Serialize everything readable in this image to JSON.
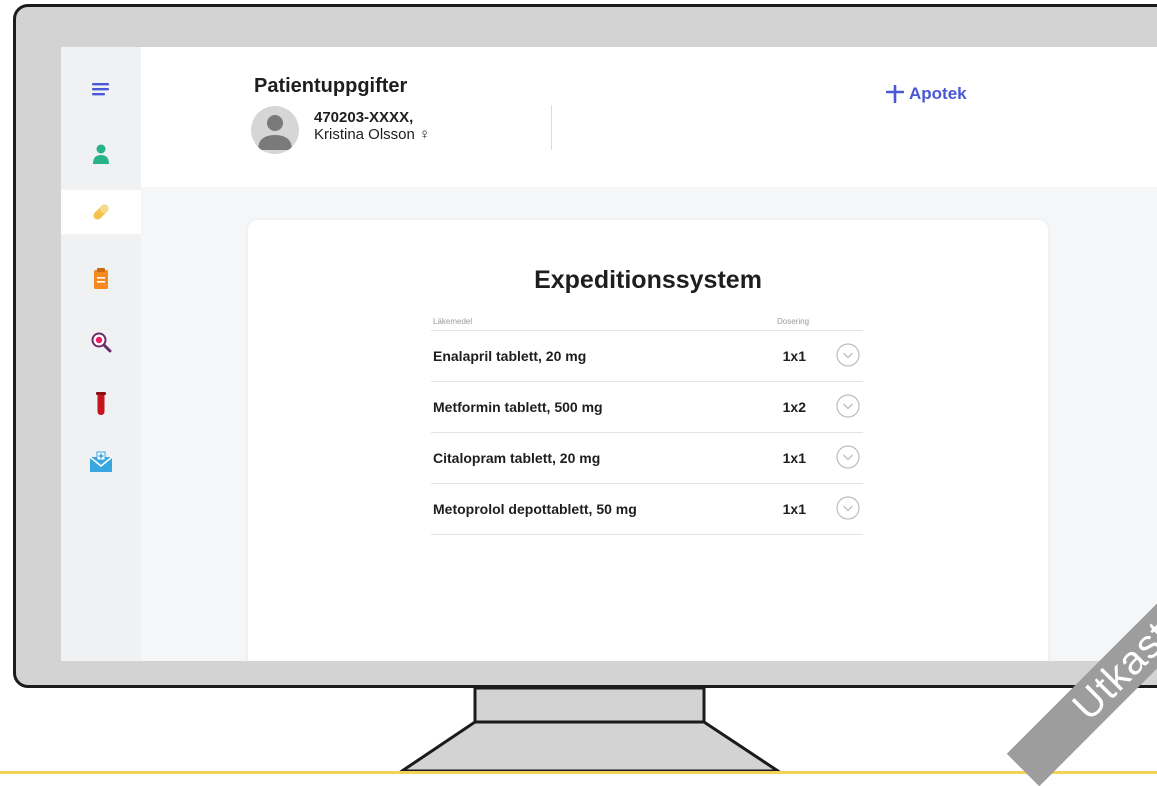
{
  "header": {
    "title": "Patientuppgifter",
    "patient_id": "470203-XXXX,",
    "patient_name": "Kristina Olsson ♀",
    "apotek_label": "Apotek"
  },
  "sidebar": {
    "items": [
      {
        "icon": "menu-icon"
      },
      {
        "icon": "patient-icon"
      },
      {
        "icon": "pill-icon",
        "active": true
      },
      {
        "icon": "document-icon"
      },
      {
        "icon": "search-zoom-icon"
      },
      {
        "icon": "test-tube-icon"
      },
      {
        "icon": "medical-mail-icon"
      }
    ]
  },
  "card": {
    "title": "Expeditionssystem",
    "columns": {
      "medication": "Läkemedel",
      "dosage": "Dosering"
    },
    "rows": [
      {
        "name": "Enalapril tablett, 20 mg",
        "dose": "1x1"
      },
      {
        "name": "Metformin tablett, 500 mg",
        "dose": "1x2"
      },
      {
        "name": "Citalopram tablett, 20 mg",
        "dose": "1x1"
      },
      {
        "name": "Metoprolol depottablett, 50 mg",
        "dose": "1x1"
      }
    ]
  },
  "watermark": {
    "text": "Utkast"
  },
  "colors": {
    "accent": "#4a58d6",
    "patient_green": "#27b38a",
    "pill_yellow": "#f5c24b",
    "doc_orange": "#f58a1f",
    "tube_red": "#c4161c",
    "mail_blue": "#3aa6e0",
    "search_purple": "#6b2c6b"
  }
}
